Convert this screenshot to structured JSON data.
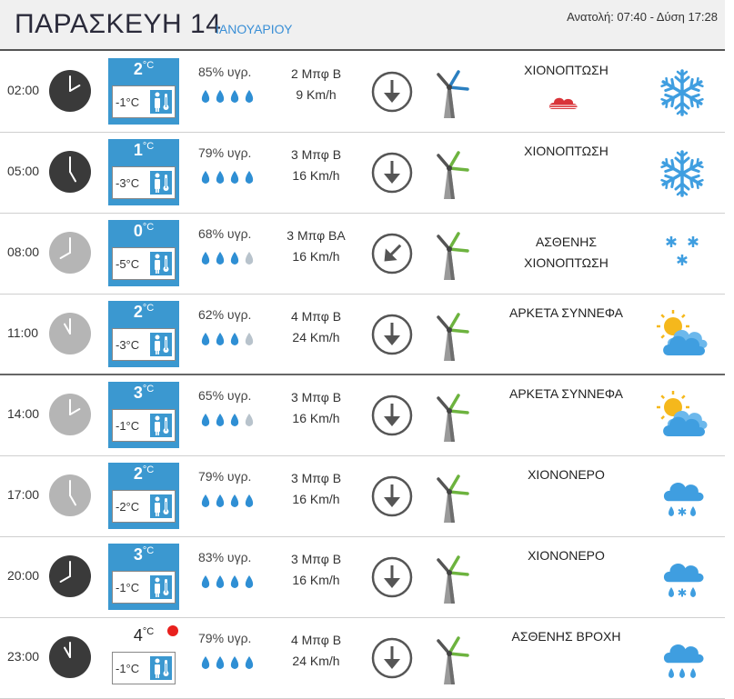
{
  "header": {
    "day": "ΠΑΡΑΣΚΕΥΗ 14",
    "month": "ΙΑΝΟΥΑΡΙΟΥ",
    "sun": "Ανατολή: 07:40  - Δύση 17:28"
  },
  "colors": {
    "accent": "#3b98d0",
    "drop_full": "#2f8fd4",
    "drop_empty": "#b8c3cc",
    "turbine_green": "#6db33f",
    "turbine_blue": "#2a7fc0"
  },
  "rows": [
    {
      "time": "02:00",
      "clock": "dark",
      "tmax": "2",
      "tmin": "-1°C",
      "humidity": "85% υγρ.",
      "drops": 4,
      "wind_bf": "2 Μπφ Β",
      "wind_kmh": "9 Km/h",
      "direction": "down",
      "turbine": "blue",
      "desc": "ΧΙΟΝΟΠΤΩΣΗ",
      "desc2": "",
      "desc_icon": "red-cloud-icon",
      "icon": "snowflake-icon",
      "boxed": true
    },
    {
      "time": "05:00",
      "clock": "dark",
      "tmax": "1",
      "tmin": "-3°C",
      "humidity": "79% υγρ.",
      "drops": 4,
      "wind_bf": "3 Μπφ Β",
      "wind_kmh": "16 Km/h",
      "direction": "down",
      "turbine": "green",
      "desc": "ΧΙΟΝΟΠΤΩΣΗ",
      "desc2": "",
      "icon": "snowflake-icon",
      "boxed": true
    },
    {
      "time": "08:00",
      "clock": "light",
      "tmax": "0",
      "tmin": "-5°C",
      "humidity": "68% υγρ.",
      "drops": 3,
      "wind_bf": "3 Μπφ ΒΑ",
      "wind_kmh": "16 Km/h",
      "direction": "down-left",
      "turbine": "green",
      "desc": "ΑΣΘΕΝΗΣ",
      "desc2": "ΧΙΟΝΟΠΤΩΣΗ",
      "icon": "light-snow-icon",
      "boxed": true
    },
    {
      "time": "11:00",
      "clock": "light",
      "tmax": "2",
      "tmin": "-3°C",
      "humidity": "62% υγρ.",
      "drops": 3,
      "wind_bf": "4 Μπφ Β",
      "wind_kmh": "24 Km/h",
      "direction": "down",
      "turbine": "green",
      "desc": "ΑΡΚΕΤΑ ΣΥΝΝΕΦΑ",
      "desc2": "",
      "icon": "sun-cloud-icon",
      "boxed": true
    },
    {
      "time": "14:00",
      "clock": "light",
      "tmax": "3",
      "tmin": "-1°C",
      "humidity": "65% υγρ.",
      "drops": 3,
      "wind_bf": "3 Μπφ Β",
      "wind_kmh": "16 Km/h",
      "direction": "down",
      "turbine": "green",
      "desc": "ΑΡΚΕΤΑ ΣΥΝΝΕΦΑ",
      "desc2": "",
      "icon": "sun-cloud-icon",
      "boxed": true
    },
    {
      "time": "17:00",
      "clock": "light",
      "tmax": "2",
      "tmin": "-2°C",
      "humidity": "79% υγρ.",
      "drops": 4,
      "wind_bf": "3 Μπφ Β",
      "wind_kmh": "16 Km/h",
      "direction": "down",
      "turbine": "green",
      "desc": "ΧΙΟΝΟΝΕΡΟ",
      "desc2": "",
      "icon": "sleet-icon",
      "boxed": true
    },
    {
      "time": "20:00",
      "clock": "dark",
      "tmax": "3",
      "tmin": "-1°C",
      "humidity": "83% υγρ.",
      "drops": 4,
      "wind_bf": "3 Μπφ Β",
      "wind_kmh": "16 Km/h",
      "direction": "down",
      "turbine": "green",
      "desc": "ΧΙΟΝΟΝΕΡΟ",
      "desc2": "",
      "icon": "sleet-icon",
      "boxed": true
    },
    {
      "time": "23:00",
      "clock": "dark",
      "tmax": "4",
      "tmin": "-1°C",
      "humidity": "79% υγρ.",
      "drops": 4,
      "wind_bf": "4 Μπφ Β",
      "wind_kmh": "24 Km/h",
      "direction": "down",
      "turbine": "green",
      "desc": "ΑΣΘΕΝΗΣ ΒΡΟΧΗ",
      "desc2": "",
      "icon": "rain-icon",
      "boxed": false,
      "red_dot": true
    }
  ],
  "deg_unit": "°C"
}
